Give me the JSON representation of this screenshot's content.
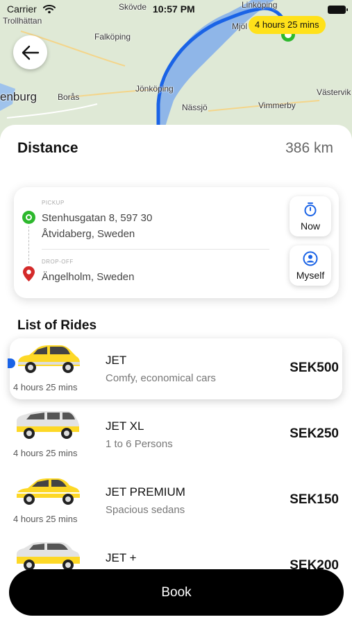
{
  "status_bar": {
    "carrier": "Carrier",
    "time": "10:57 PM"
  },
  "map": {
    "labels": {
      "trollhattan": "Trollhättan",
      "skovde": "Skövde",
      "linkoping": "Linköping",
      "mjol": "Mjöl",
      "falkoping": "Falköping",
      "goteborg": "enburg",
      "boras": "Borås",
      "jonkoping": "Jönköping",
      "nassjo": "Nässjö",
      "vimmerby": "Vimmerby",
      "vastervik": "Västervik"
    },
    "eta_badge": "4 hours 25 mins",
    "colors": {
      "land": "#dfe9d6",
      "water": "#8fb6e8",
      "route": "#1a63e6",
      "badge": "#ffe11a"
    }
  },
  "distance": {
    "label": "Distance",
    "value": "386 km"
  },
  "location": {
    "pickup_label": "PICKUP",
    "pickup_address": "Stenhusgatan 8, 597 30 Åtvidaberg, Sweden",
    "dropoff_label": "DROP-OFF",
    "dropoff_address": "Ängelholm, Sweden",
    "when_button": "Now",
    "who_button": "Myself",
    "icons": {
      "pickup": "pickup-dot-icon",
      "dropoff": "location-pin-icon",
      "when": "stopwatch-icon",
      "who": "user-circle-icon"
    }
  },
  "rides": {
    "title": "List of Rides",
    "items": [
      {
        "name": "JET",
        "description": "Comfy, economical cars",
        "duration": "4 hours 25 mins",
        "price": "SEK500",
        "selected": true
      },
      {
        "name": "JET XL",
        "description": "1 to 6 Persons",
        "duration": "4 hours 25 mins",
        "price": "SEK250",
        "selected": false
      },
      {
        "name": "JET PREMIUM",
        "description": "Spacious sedans",
        "duration": "4 hours 25 mins",
        "price": "SEK150",
        "selected": false
      },
      {
        "name": "JET +",
        "description": "",
        "duration": "",
        "price": "SEK200",
        "selected": false
      }
    ]
  },
  "book_button": "Book"
}
